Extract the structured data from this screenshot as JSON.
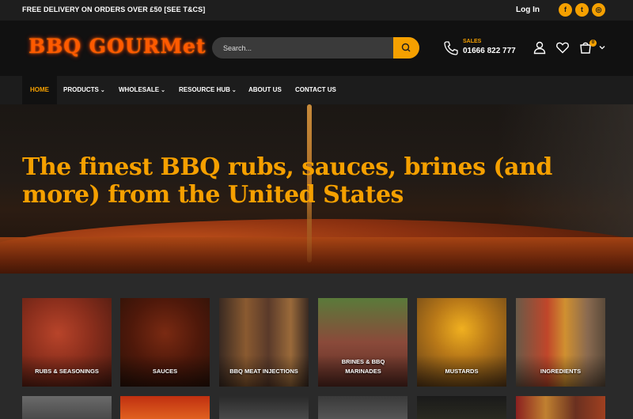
{
  "topbar": {
    "promo": "FREE DELIVERY ON ORDERS OVER £50 [SEE T&CS]",
    "login": "Log In",
    "social": [
      {
        "name": "facebook-icon",
        "glyph": "f"
      },
      {
        "name": "twitter-icon",
        "glyph": "t"
      },
      {
        "name": "instagram-icon",
        "glyph": "◎"
      }
    ]
  },
  "header": {
    "logo": "BBQ GOURMet",
    "search_placeholder": "Search...",
    "sales_label": "SALES",
    "sales_phone": "01666 822 777",
    "cart_count": "0"
  },
  "nav": {
    "items": [
      {
        "label": "HOME",
        "active": true
      },
      {
        "label": "PRODUCTS",
        "caret": "⌄"
      },
      {
        "label": "WHOLESALE",
        "caret": "⌄"
      },
      {
        "label": "RESOURCE HUB",
        "caret": "⌄"
      },
      {
        "label": "ABOUT US"
      },
      {
        "label": "CONTACT US"
      }
    ]
  },
  "hero": {
    "title": "The finest BBQ rubs, sauces, brines (and more) from the United States"
  },
  "categories": [
    {
      "label": "RUBS & SEASONINGS"
    },
    {
      "label": "SAUCES"
    },
    {
      "label": "BBQ MEAT INJECTIONS"
    },
    {
      "label": "BRINES & BBQ MARINADES"
    },
    {
      "label": "MUSTARDS"
    },
    {
      "label": "INGREDIENTS"
    }
  ],
  "colors": {
    "accent": "#f5a000",
    "topbar": "#1e1e1e",
    "header": "#111111",
    "nav": "#1c1c1c",
    "body": "#2a2a2a"
  }
}
